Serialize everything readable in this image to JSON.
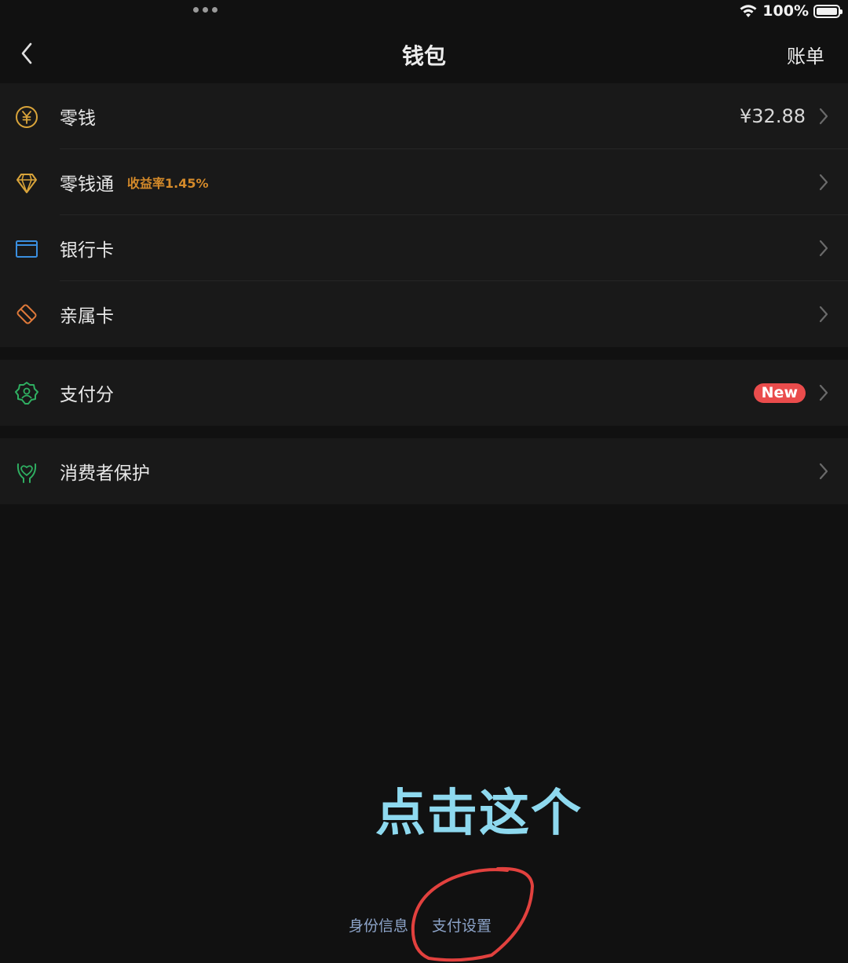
{
  "status_bar": {
    "battery_text": "100%",
    "icons": [
      "wifi-icon",
      "battery-icon"
    ]
  },
  "nav": {
    "back_icon": "chevron-left-icon",
    "title": "钱包",
    "right_action": "账单"
  },
  "group1": [
    {
      "label": "零钱",
      "icon": "yuan-coin-icon",
      "value": "¥32.88"
    },
    {
      "label": "零钱通",
      "icon": "diamond-icon",
      "tag": "收益率1.45%"
    },
    {
      "label": "银行卡",
      "icon": "bank-card-icon"
    },
    {
      "label": "亲属卡",
      "icon": "family-card-icon"
    }
  ],
  "group2": [
    {
      "label": "支付分",
      "icon": "badge-user-icon",
      "badge": "New"
    }
  ],
  "group3": [
    {
      "label": "消费者保护",
      "icon": "protect-hands-icon"
    }
  ],
  "overlay": {
    "instruction": "点击这个"
  },
  "bottom_links": {
    "identity": "身份信息",
    "payment_settings": "支付设置"
  },
  "colors": {
    "background": "#111111",
    "row_bg": "#191919",
    "accent_orange": "#d48a2a",
    "link_blue": "#8da4c9",
    "badge_red": "#ea4c4c",
    "overlay_cyan": "#8ed9ef",
    "circle_red": "#e2413e"
  }
}
